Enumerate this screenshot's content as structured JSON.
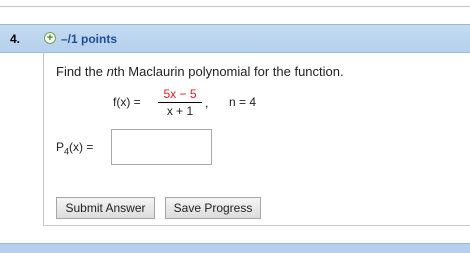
{
  "question": {
    "number": "4.",
    "points": "–/1 points",
    "prompt_before": "Find the ",
    "prompt_italic": "n",
    "prompt_after": "th Maclaurin polynomial for the function.",
    "function_label": "f(x) =",
    "numerator": "5x − 5",
    "denominator": "x + 1",
    "comma": ",",
    "n_value": "n = 4",
    "poly_label_main": "P",
    "poly_label_sub": "4",
    "poly_label_rest": "(x) =",
    "answer_value": ""
  },
  "buttons": {
    "submit_label": "Submit Answer",
    "save_label": "Save Progress"
  },
  "colors": {
    "header": "#b5d0ec",
    "points_text": "#1d4f99",
    "numerator": "#d12020",
    "plus_icon": "#3f8a24"
  }
}
